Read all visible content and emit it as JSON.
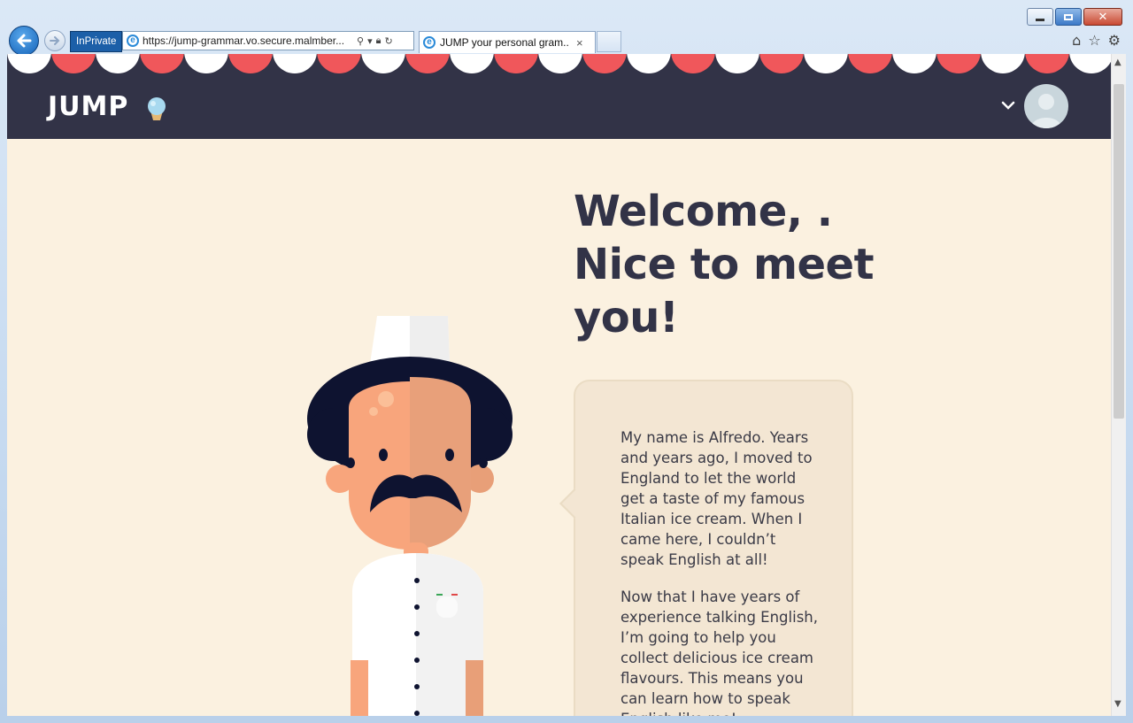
{
  "browser": {
    "inprivate_label": "InPrivate",
    "url": "https://jump-grammar.vo.secure.malmber...",
    "tab_title": "JUMP your personal gram...",
    "tab_close": "×"
  },
  "header": {
    "logo_text": "JUMP"
  },
  "welcome": {
    "heading": "Welcome, . Nice to meet you!"
  },
  "speech_bubble": {
    "paragraph_1": "My name is Alfredo. Years and years ago, I moved to England to let the world get a taste of my famous Italian ice cream. When I came here, I couldn’t speak English at all!",
    "paragraph_2": "Now that I have years of experience talking English, I’m going to help you collect delicious ice cream flavours. This means you can learn how to speak English like me!"
  },
  "colors": {
    "navy": "#323347",
    "cream": "#fbf1e0",
    "bubble": "#f3e6d3",
    "awning_red": "#f0575b",
    "awning_white": "#ffffff"
  },
  "icons": {
    "back": "back-arrow-icon",
    "forward": "forward-arrow-icon",
    "home": "home-icon",
    "favorites": "star-icon",
    "settings": "gear-icon",
    "profile_toggle": "chevron-down-icon"
  }
}
